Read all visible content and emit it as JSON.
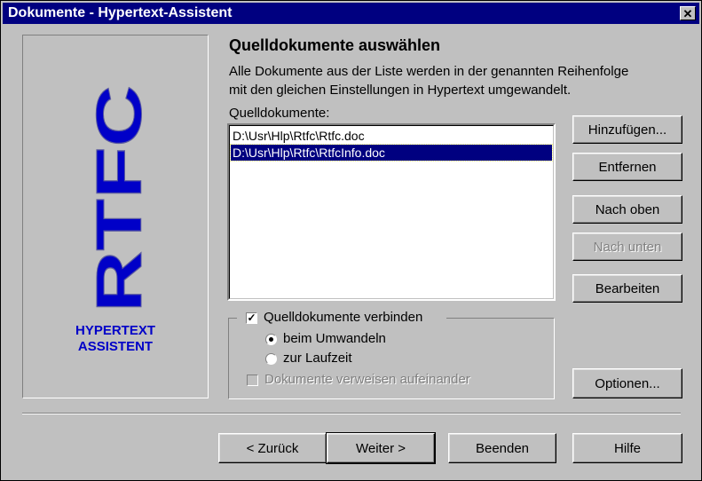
{
  "window": {
    "title": "Dokumente - Hypertext-Assistent",
    "close_glyph": "✕"
  },
  "logo": {
    "mark": "RTFC",
    "subtitle_line1": "HYPERTEXT",
    "subtitle_line2": "ASSISTENT",
    "color": "#0000c8"
  },
  "page": {
    "heading": "Quelldokumente auswählen",
    "description_line1": "Alle Dokumente aus der Liste werden in der genannten Reihenfolge",
    "description_line2": "mit den gleichen Einstellungen in Hypertext umgewandelt.",
    "list_label": "Quelldokumente:"
  },
  "documents": [
    {
      "path": "D:\\Usr\\Hlp\\Rtfc\\Rtfc.doc",
      "selected": false
    },
    {
      "path": "D:\\Usr\\Hlp\\Rtfc\\RtfcInfo.doc",
      "selected": true
    }
  ],
  "side_buttons": {
    "add": "Hinzufügen...",
    "remove": "Entfernen",
    "up": "Nach oben",
    "down": "Nach unten",
    "edit": "Bearbeiten",
    "options": "Optionen..."
  },
  "merge_group": {
    "checkbox_label": "Quelldokumente verbinden",
    "checked": true,
    "radio_convert": "beim Umwandeln",
    "radio_runtime": "zur Laufzeit",
    "selected_radio": "convert",
    "crossref_label": "Dokumente verweisen aufeinander",
    "crossref_checked": false
  },
  "nav_buttons": {
    "back": "< Zurück",
    "next": "Weiter >",
    "finish": "Beenden",
    "help": "Hilfe"
  }
}
